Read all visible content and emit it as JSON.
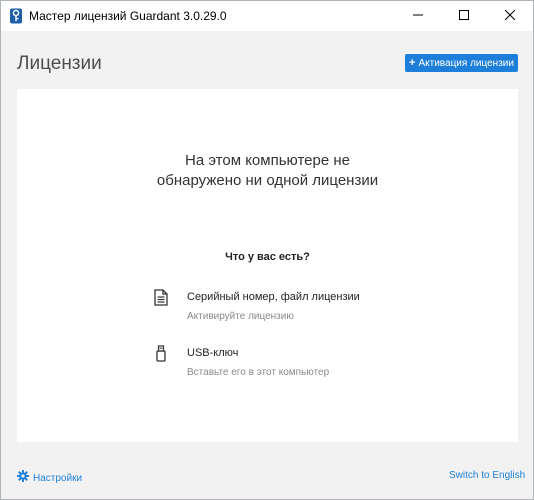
{
  "window": {
    "title": "Мастер лицензий Guardant 3.0.29.0",
    "icon": "guardant-key-icon",
    "controls": [
      "minimize-icon",
      "maximize-icon",
      "close-icon"
    ]
  },
  "header": {
    "title": "Лицензии",
    "activate_button": {
      "icon": "plus-icon",
      "label": "Активация лицензии"
    }
  },
  "main": {
    "empty_message": {
      "line1": "На этом компьютере не",
      "line2": "обнаружено ни одной лицензии"
    },
    "question": "Что у вас есть?",
    "options": [
      {
        "icon": "document-icon",
        "label": "Серийный номер, файл лицензии",
        "hint": "Активируйте лицензию"
      },
      {
        "icon": "usb-key-icon",
        "label": "USB-ключ",
        "hint": "Вставьте его в этот компьютер"
      }
    ]
  },
  "footer": {
    "settings": {
      "icon": "gear-icon",
      "label": "Настройки"
    },
    "language_link": "Switch to English"
  },
  "colors": {
    "accent": "#1e7fdb",
    "background": "#f2f2f2",
    "panel": "#ffffff",
    "muted_text": "#8a8a8a"
  }
}
